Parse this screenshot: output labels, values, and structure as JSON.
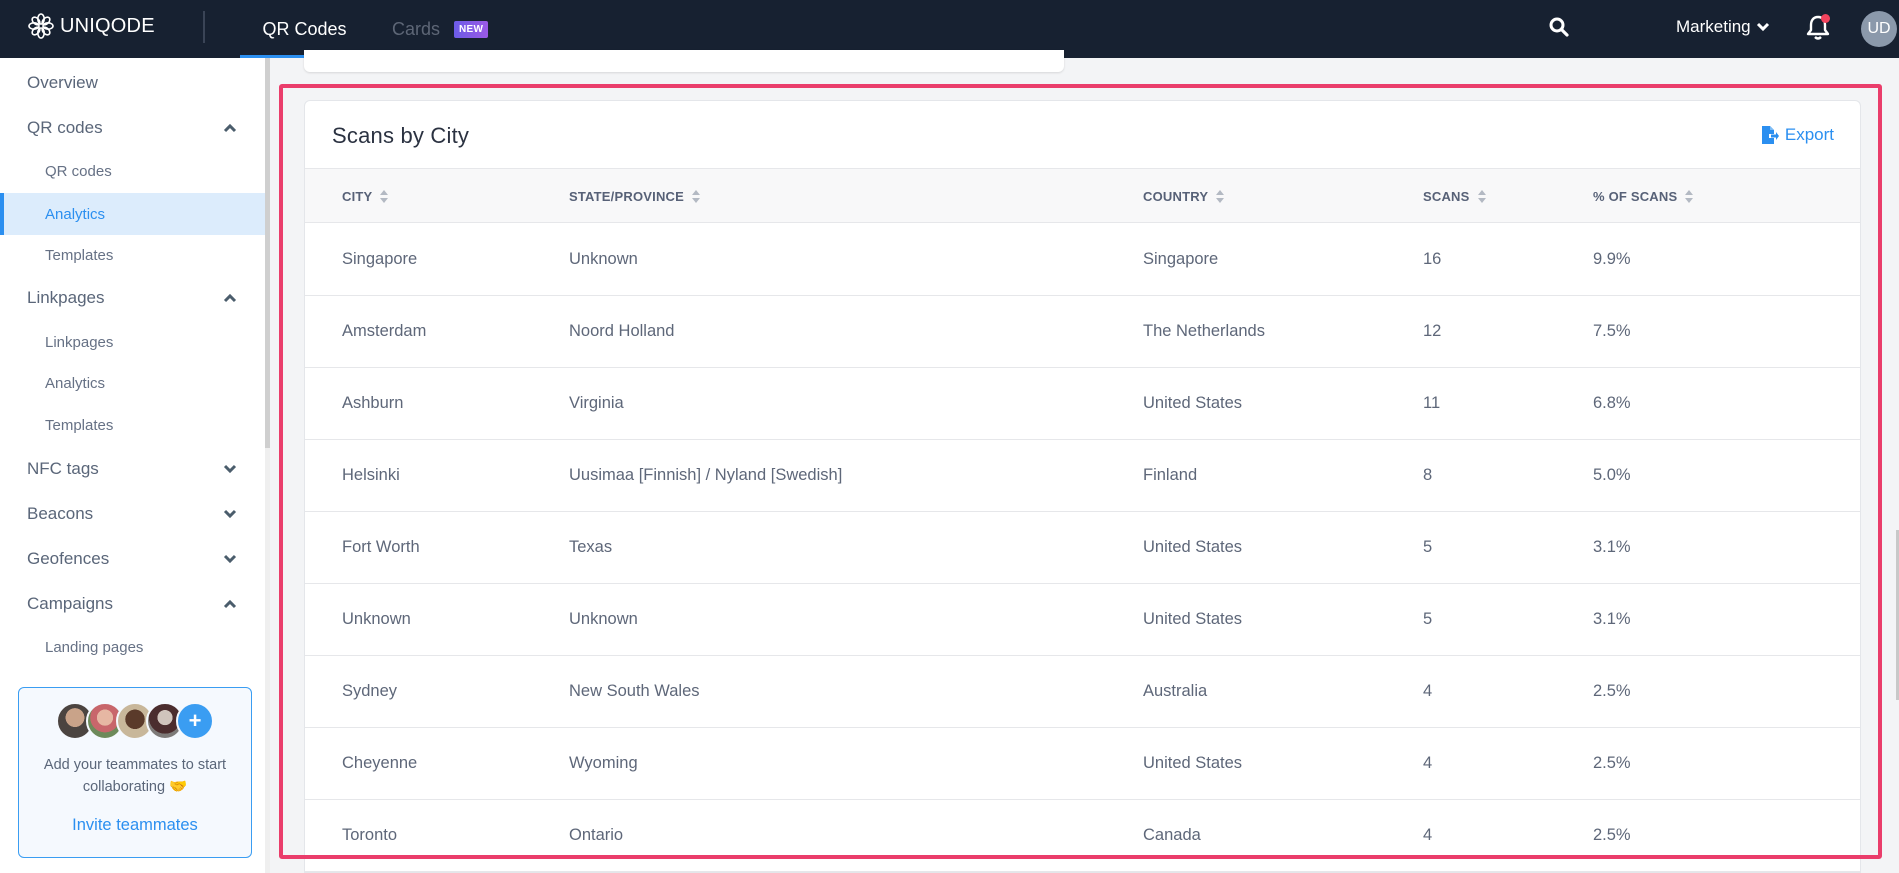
{
  "app": {
    "brand": "UNIQODE",
    "tabs": [
      {
        "label": "QR Codes",
        "active": true
      },
      {
        "label": "Cards",
        "active": false,
        "badge": "NEW"
      }
    ],
    "workspace": "Marketing",
    "user_initials": "UD",
    "icons": {
      "logo": "flower-logo-icon",
      "search": "search-icon",
      "workspace_dropdown": "chevron-down-icon",
      "notifications": "bell-icon"
    },
    "colors": {
      "nav_bg": "#172131",
      "accent": "#2b8ff0",
      "highlight": "#ea3d6b",
      "notification_dot": "#f2435d"
    }
  },
  "sidebar": {
    "items": [
      {
        "label": "Overview",
        "level": "top"
      },
      {
        "label": "QR codes",
        "level": "top",
        "expanded": true
      },
      {
        "label": "QR codes",
        "level": "sub"
      },
      {
        "label": "Analytics",
        "level": "sub",
        "active": true
      },
      {
        "label": "Templates",
        "level": "sub"
      },
      {
        "label": "Linkpages",
        "level": "top",
        "expanded": true
      },
      {
        "label": "Linkpages",
        "level": "sub"
      },
      {
        "label": "Analytics",
        "level": "sub"
      },
      {
        "label": "Templates",
        "level": "sub"
      },
      {
        "label": "NFC tags",
        "level": "top",
        "expanded": false
      },
      {
        "label": "Beacons",
        "level": "top",
        "expanded": false
      },
      {
        "label": "Geofences",
        "level": "top",
        "expanded": false
      },
      {
        "label": "Campaigns",
        "level": "top",
        "expanded": true
      },
      {
        "label": "Landing pages",
        "level": "sub"
      }
    ],
    "invite": {
      "text": "Add your teammates to start collaborating 🤝",
      "link": "Invite teammates",
      "plus": "+"
    }
  },
  "main": {
    "card_title": "Scans by City",
    "export_label": "Export",
    "columns": [
      "CITY",
      "STATE/PROVINCE",
      "COUNTRY",
      "SCANS",
      "% OF SCANS"
    ],
    "rows": [
      {
        "city": "Singapore",
        "state": "Unknown",
        "country": "Singapore",
        "scans": "16",
        "percent": "9.9%"
      },
      {
        "city": "Amsterdam",
        "state": "Noord Holland",
        "country": "The Netherlands",
        "scans": "12",
        "percent": "7.5%"
      },
      {
        "city": "Ashburn",
        "state": "Virginia",
        "country": "United States",
        "scans": "11",
        "percent": "6.8%"
      },
      {
        "city": "Helsinki",
        "state": "Uusimaa [Finnish] / Nyland [Swedish]",
        "country": "Finland",
        "scans": "8",
        "percent": "5.0%"
      },
      {
        "city": "Fort Worth",
        "state": "Texas",
        "country": "United States",
        "scans": "5",
        "percent": "3.1%"
      },
      {
        "city": "Unknown",
        "state": "Unknown",
        "country": "United States",
        "scans": "5",
        "percent": "3.1%"
      },
      {
        "city": "Sydney",
        "state": "New South Wales",
        "country": "Australia",
        "scans": "4",
        "percent": "2.5%"
      },
      {
        "city": "Cheyenne",
        "state": "Wyoming",
        "country": "United States",
        "scans": "4",
        "percent": "2.5%"
      },
      {
        "city": "Toronto",
        "state": "Ontario",
        "country": "Canada",
        "scans": "4",
        "percent": "2.5%"
      }
    ]
  }
}
